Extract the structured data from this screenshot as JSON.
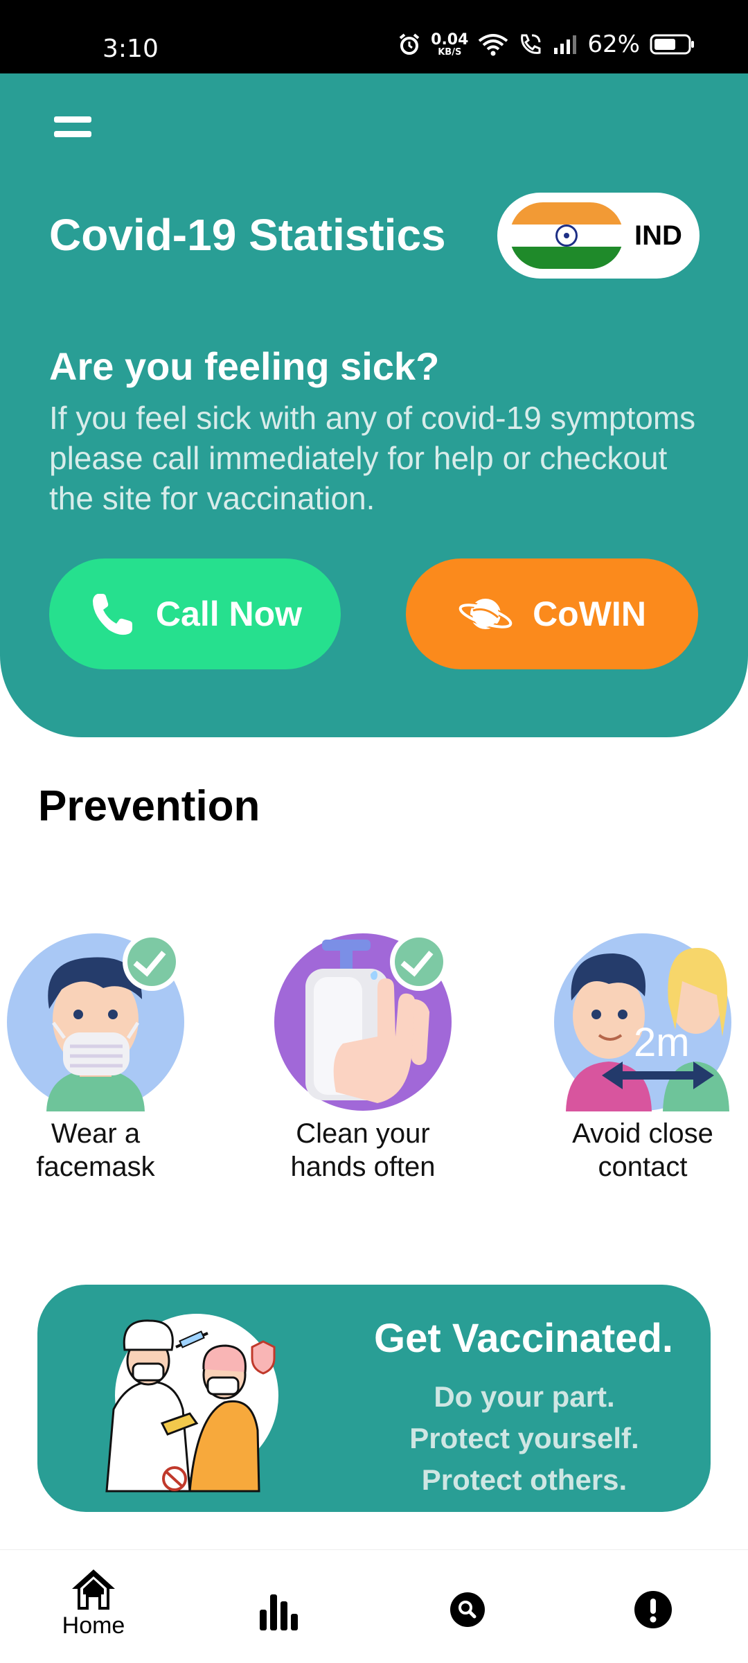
{
  "status_bar": {
    "time": "3:10",
    "net_speed_value": "0.04",
    "net_speed_unit": "KB/S",
    "battery_percent": "62%",
    "icons": [
      "alarm-icon",
      "wifi-icon",
      "wifi-calling-icon",
      "signal-icon",
      "battery-icon"
    ]
  },
  "header": {
    "menu_icon": "hamburger-menu-icon",
    "title": "Covid-19 Statistics",
    "country": {
      "code": "IND",
      "flag": "india-flag"
    },
    "sick_title": "Are you feeling sick?",
    "sick_body": "If you feel sick with any of covid-19 symptoms please call immediately for help or checkout the site for vaccination.",
    "call_button": {
      "label": "Call Now",
      "icon": "phone-icon"
    },
    "cowin_button": {
      "label": "CoWIN",
      "icon": "planet-icon"
    }
  },
  "prevention": {
    "title": "Prevention",
    "items": [
      {
        "label_line1": "Wear a",
        "label_line2": "facemask",
        "icon": "facemask-illustration"
      },
      {
        "label_line1": "Clean your",
        "label_line2": "hands often",
        "icon": "handwash-illustration"
      },
      {
        "label_line1": "Avoid close",
        "label_line2": "contact",
        "icon": "distance-illustration",
        "badge": "2m"
      }
    ]
  },
  "vaccine_card": {
    "title": "Get Vaccinated.",
    "lines": [
      "Do your part.",
      "Protect yourself.",
      "Protect others."
    ],
    "illustration": "doctor-vaccinating-patient-illustration"
  },
  "bottom_nav": {
    "items": [
      {
        "label": "Home",
        "icon": "home-icon",
        "active": true
      },
      {
        "label": "",
        "icon": "bar-chart-icon"
      },
      {
        "label": "",
        "icon": "search-icon"
      },
      {
        "label": "",
        "icon": "alert-icon"
      }
    ]
  },
  "colors": {
    "primary": "#299e95",
    "call_green": "#26e08e",
    "cowin_orange": "#fb8a1c"
  }
}
